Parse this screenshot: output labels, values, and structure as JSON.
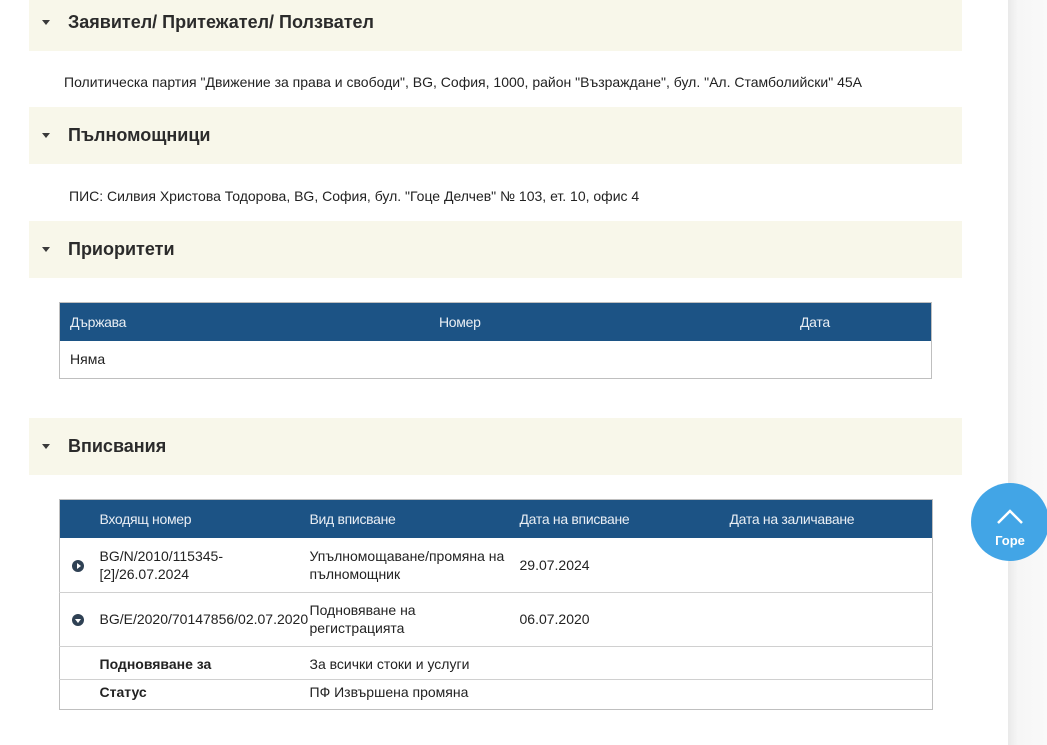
{
  "sections": {
    "applicant": {
      "title": "Заявител/ Притежател/ Ползвател",
      "text": "Политическа партия \"Движение за права и свободи\", BG, София, 1000, район \"Възраждане\", бул. \"Ал. Стамболийски\" 45А"
    },
    "representatives": {
      "title": "Пълномощници",
      "text": "ПИС: Силвия Христова Тодорова, BG, София, бул. \"Гоце Делчев\" № 103, ет. 10, офис 4"
    },
    "priorities": {
      "title": "Приоритети",
      "columns": [
        "Държава",
        "Номер",
        "Дата"
      ],
      "empty_text": "Няма"
    },
    "entries": {
      "title": "Вписвания",
      "columns": [
        "Входящ номер",
        "Вид вписване",
        "Дата на вписване",
        "Дата на заличаване"
      ],
      "rows": [
        {
          "number_line1": "BG/N/2010/115345-",
          "number_line2": "[2]/26.07.2024",
          "type_line1": "Упълномощаване/промяна на",
          "type_line2": "пълномощник",
          "date": "29.07.2024",
          "deleted": "",
          "expanded": false
        },
        {
          "number_line1": "BG/E/2020/70147856/02.07.2020",
          "type_line1": "Подновяване на",
          "type_line2": "регистрацията",
          "date": "06.07.2020",
          "deleted": "",
          "expanded": true
        }
      ],
      "details": [
        {
          "label": "Подновяване за",
          "value": "За всички стоки и услуги"
        },
        {
          "label": "Статус",
          "value": "ПФ Извършена промяна"
        }
      ]
    }
  },
  "top_button": {
    "label": "Горе",
    "icon": "chevron-up-icon"
  },
  "colors": {
    "header_bg": "#f8f7ea",
    "table_header": "#1c5385",
    "top_button": "#42a5e6"
  }
}
